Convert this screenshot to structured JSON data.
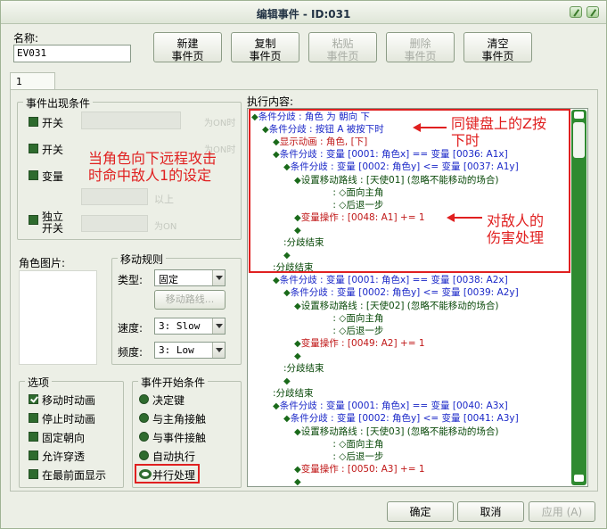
{
  "window": {
    "title": "编辑事件 - ID:031"
  },
  "name": {
    "label": "名称:",
    "value": "EV031"
  },
  "toolbar": {
    "new_page": [
      "新建",
      "事件页"
    ],
    "copy_page": [
      "复制",
      "事件页"
    ],
    "paste_page": [
      "粘贴",
      "事件页"
    ],
    "delete_page": [
      "删除",
      "事件页"
    ],
    "clear_page": [
      "清空",
      "事件页"
    ]
  },
  "tab": {
    "label": "1"
  },
  "conditions": {
    "title": "事件出现条件",
    "switch1": "开关",
    "switch2": "开关",
    "variable": "变量",
    "self_switch": [
      "独立",
      "开关"
    ],
    "on1": "为ON时",
    "on2": "为ON时",
    "above": "以上",
    "on3": "为ON"
  },
  "graphic": {
    "label": "角色图片:"
  },
  "movement": {
    "title": "移动规则",
    "type_label": "类型:",
    "type_value": "固定",
    "route_button": "移动路线...",
    "speed_label": "速度:",
    "speed_value": "3: Slow",
    "freq_label": "频度:",
    "freq_value": "3: Low"
  },
  "options": {
    "title": "选项",
    "items": [
      {
        "label": "移动时动画",
        "checked": true
      },
      {
        "label": "停止时动画",
        "checked": false
      },
      {
        "label": "固定朝向",
        "checked": false
      },
      {
        "label": "允许穿透",
        "checked": false
      },
      {
        "label": "在最前面显示",
        "checked": false
      }
    ]
  },
  "trigger": {
    "title": "事件开始条件",
    "items": [
      {
        "label": "决定键",
        "selected": false
      },
      {
        "label": "与主角接触",
        "selected": false
      },
      {
        "label": "与事件接触",
        "selected": false
      },
      {
        "label": "自动执行",
        "selected": false
      },
      {
        "label": "并行处理",
        "selected": true
      }
    ]
  },
  "contents": {
    "label": "执行内容:",
    "lines": [
      {
        "indent": 0,
        "text": "条件分歧 : 角色 为 朝向 下",
        "color": "blue",
        "dia": true
      },
      {
        "indent": 1,
        "text": "条件分歧 : 按钮 A 被按下时",
        "color": "blue",
        "dia": true
      },
      {
        "indent": 2,
        "text": "显示动画 : 角色, [下]",
        "color": "red",
        "dia": true
      },
      {
        "indent": 2,
        "text": "条件分歧 : 变量 [0001: 角色x] == 变量 [0036: A1x]",
        "color": "blue",
        "dia": true
      },
      {
        "indent": 3,
        "text": "条件分歧 : 变量 [0002: 角色y] <= 变量 [0037: A1y]",
        "color": "blue",
        "dia": true
      },
      {
        "indent": 4,
        "text": "设置移动路线 : [天使01] (忽略不能移动的场合)",
        "color": "dark",
        "dia": true
      },
      {
        "indent": 4,
        "text": "             : ◇面向主角",
        "color": "dark",
        "dia": false
      },
      {
        "indent": 4,
        "text": "             : ◇后退一步",
        "color": "dark",
        "dia": false
      },
      {
        "indent": 4,
        "text": "变量操作 : [0048: A1] += 1",
        "color": "red",
        "dia": true
      },
      {
        "indent": 4,
        "text": "",
        "color": "dark",
        "dia": true
      },
      {
        "indent": 3,
        "text": ":分歧结束",
        "color": "dark",
        "dia": false
      },
      {
        "indent": 3,
        "text": "",
        "color": "dark",
        "dia": true
      },
      {
        "indent": 2,
        "text": ":分歧结束",
        "color": "dark",
        "dia": false
      },
      {
        "indent": 2,
        "text": "条件分歧 : 变量 [0001: 角色x] == 变量 [0038: A2x]",
        "color": "blue",
        "dia": true
      },
      {
        "indent": 3,
        "text": "条件分歧 : 变量 [0002: 角色y] <= 变量 [0039: A2y]",
        "color": "blue",
        "dia": true
      },
      {
        "indent": 4,
        "text": "设置移动路线 : [天使02] (忽略不能移动的场合)",
        "color": "dark",
        "dia": true
      },
      {
        "indent": 4,
        "text": "             : ◇面向主角",
        "color": "dark",
        "dia": false
      },
      {
        "indent": 4,
        "text": "             : ◇后退一步",
        "color": "dark",
        "dia": false
      },
      {
        "indent": 4,
        "text": "变量操作 : [0049: A2] += 1",
        "color": "red",
        "dia": true
      },
      {
        "indent": 4,
        "text": "",
        "color": "dark",
        "dia": true
      },
      {
        "indent": 3,
        "text": ":分歧结束",
        "color": "dark",
        "dia": false
      },
      {
        "indent": 3,
        "text": "",
        "color": "dark",
        "dia": true
      },
      {
        "indent": 2,
        "text": ":分歧结束",
        "color": "dark",
        "dia": false
      },
      {
        "indent": 2,
        "text": "条件分歧 : 变量 [0001: 角色x] == 变量 [0040: A3x]",
        "color": "blue",
        "dia": true
      },
      {
        "indent": 3,
        "text": "条件分歧 : 变量 [0002: 角色y] <= 变量 [0041: A3y]",
        "color": "blue",
        "dia": true
      },
      {
        "indent": 4,
        "text": "设置移动路线 : [天使03] (忽略不能移动的场合)",
        "color": "dark",
        "dia": true
      },
      {
        "indent": 4,
        "text": "             : ◇面向主角",
        "color": "dark",
        "dia": false
      },
      {
        "indent": 4,
        "text": "             : ◇后退一步",
        "color": "dark",
        "dia": false
      },
      {
        "indent": 4,
        "text": "变量操作 : [0050: A3] += 1",
        "color": "red",
        "dia": true
      },
      {
        "indent": 4,
        "text": "",
        "color": "dark",
        "dia": true
      }
    ]
  },
  "annotations": {
    "left": [
      "当角色向下远程攻击",
      "时命中敌人1的设定"
    ],
    "top": [
      "同键盘上的Z按",
      "下时"
    ],
    "damage": [
      "对敌人的",
      "伤害处理"
    ]
  },
  "footer": {
    "ok": "确定",
    "cancel": "取消",
    "apply": "应用 (A)"
  }
}
